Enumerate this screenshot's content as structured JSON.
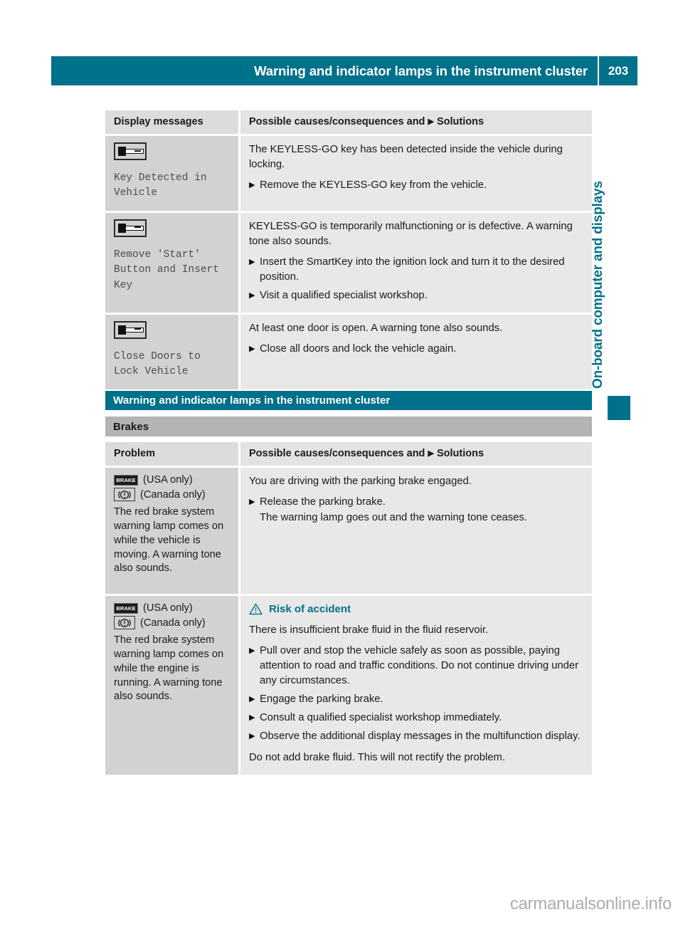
{
  "header": {
    "title": "Warning and indicator lamps in the instrument cluster",
    "page_number": "203"
  },
  "side_tab": {
    "label": "On-board computer and displays",
    "accent_color": "#00718a"
  },
  "watermark": {
    "text": "carmanualsonline.info"
  },
  "messages_table": {
    "col_left_header": "Display messages",
    "col_right_header_pre": "Possible causes/consequences and",
    "col_right_header_post": "Solutions",
    "rows": [
      {
        "icon": "keyless-go-key-icon",
        "message": "Key Detected in\nVehicle",
        "cause": "The KEYLESS-GO key has been detected inside the vehicle during locking.",
        "solutions": [
          "Remove the KEYLESS-GO key from the vehicle."
        ]
      },
      {
        "icon": "keyless-go-key-icon",
        "message": "Remove 'Start'\nButton and Insert\nKey",
        "cause": "KEYLESS-GO is temporarily malfunctioning or is defective. A warning tone also sounds.",
        "solutions": [
          "Insert the SmartKey into the ignition lock and turn it to the desired position.",
          "Visit a qualified specialist workshop."
        ]
      },
      {
        "icon": "keyless-go-key-icon",
        "message": "Close Doors to\nLock Vehicle",
        "cause": "At least one door is open. A warning tone also sounds.",
        "solutions": [
          "Close all doors and lock the vehicle again."
        ]
      }
    ]
  },
  "section": {
    "heading": "Warning and indicator lamps in the instrument cluster",
    "subheading": "Brakes"
  },
  "brakes_table": {
    "col_left_header": "Problem",
    "col_right_header_pre": "Possible causes/consequences and",
    "col_right_header_post": "Solutions",
    "rows": [
      {
        "icon_usa_label": "BRAKE",
        "usa_note": "(USA only)",
        "canada_note": "(Canada only)",
        "problem": "The red brake system warning lamp comes on while the vehicle is moving. A warning tone also sounds.",
        "cause": "You are driving with the parking brake engaged.",
        "solutions": [
          {
            "main": "Release the parking brake.",
            "sub": "The warning lamp goes out and the warning tone ceases."
          }
        ],
        "warning": null,
        "footnote": null
      },
      {
        "icon_usa_label": "BRAKE",
        "usa_note": "(USA only)",
        "canada_note": "(Canada only)",
        "problem": "The red brake system warning lamp comes on while the engine is running. A warning tone also sounds.",
        "warning": "Risk of accident",
        "cause": "There is insufficient brake fluid in the fluid reservoir.",
        "solutions": [
          {
            "main": "Pull over and stop the vehicle safely as soon as possible, paying attention to road and traffic conditions. Do not continue driving under any circumstances.",
            "sub": null
          },
          {
            "main": "Engage the parking brake.",
            "sub": null
          },
          {
            "main": "Consult a qualified specialist workshop immediately.",
            "sub": null
          },
          {
            "main": "Observe the additional display messages in the multifunction display.",
            "sub": null
          }
        ],
        "footnote": "Do not add brake fluid. This will not rectify the problem."
      }
    ]
  }
}
